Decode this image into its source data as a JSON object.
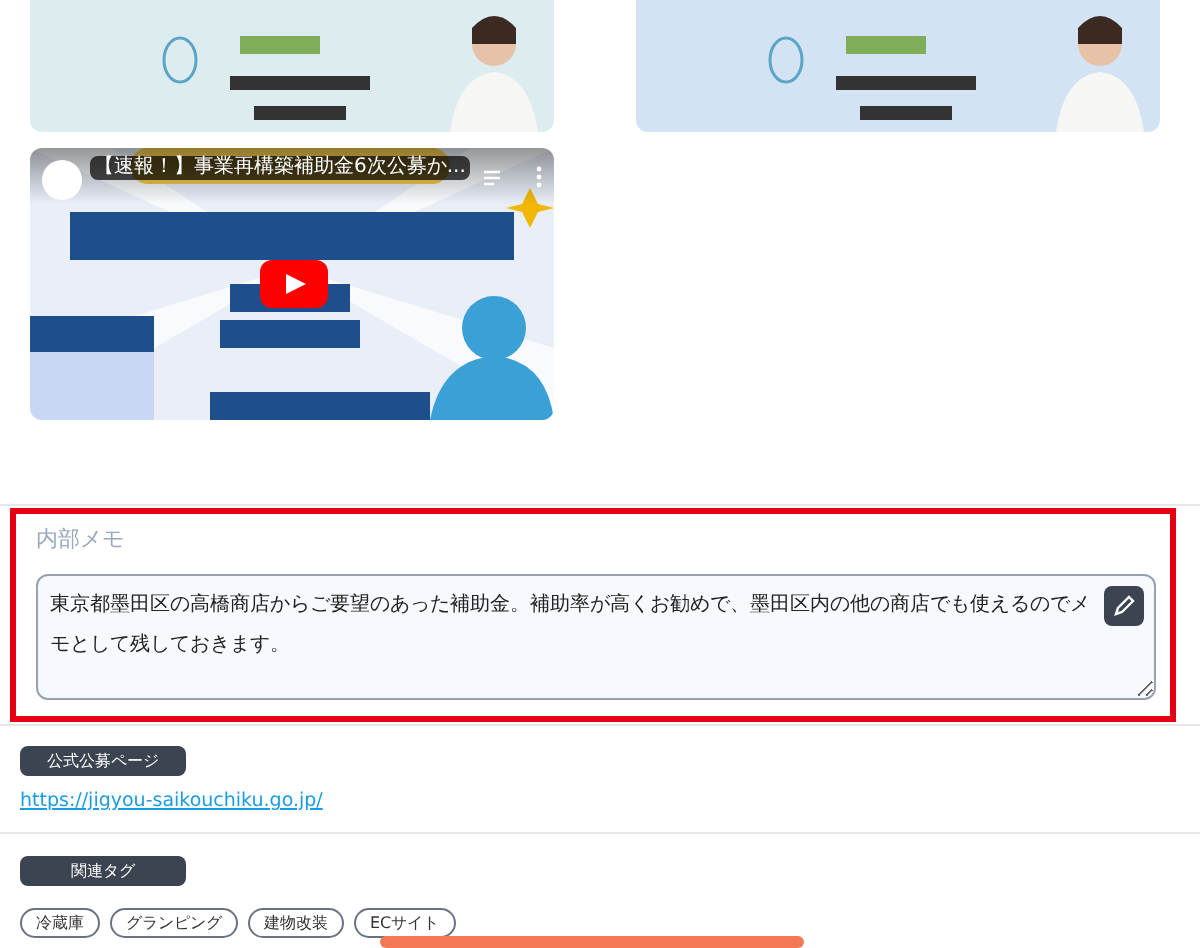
{
  "video": {
    "title": "【速報！】事業再構築補助金6次公募か..."
  },
  "memo": {
    "label": "内部メモ",
    "value": "東京都墨田区の高橋商店からご要望のあった補助金。補助率が高くお勧めで、墨田区内の他の商店でも使えるのでメモとして残しておきます。",
    "highlighted": true
  },
  "official_page": {
    "heading": "公式公募ページ",
    "link": "https://jigyou-saikouchiku.go.jp/"
  },
  "related_tags": {
    "heading": "関連タグ",
    "tags": [
      "冷蔵庫",
      "グランピング",
      "建物改装",
      "ECサイト"
    ]
  }
}
